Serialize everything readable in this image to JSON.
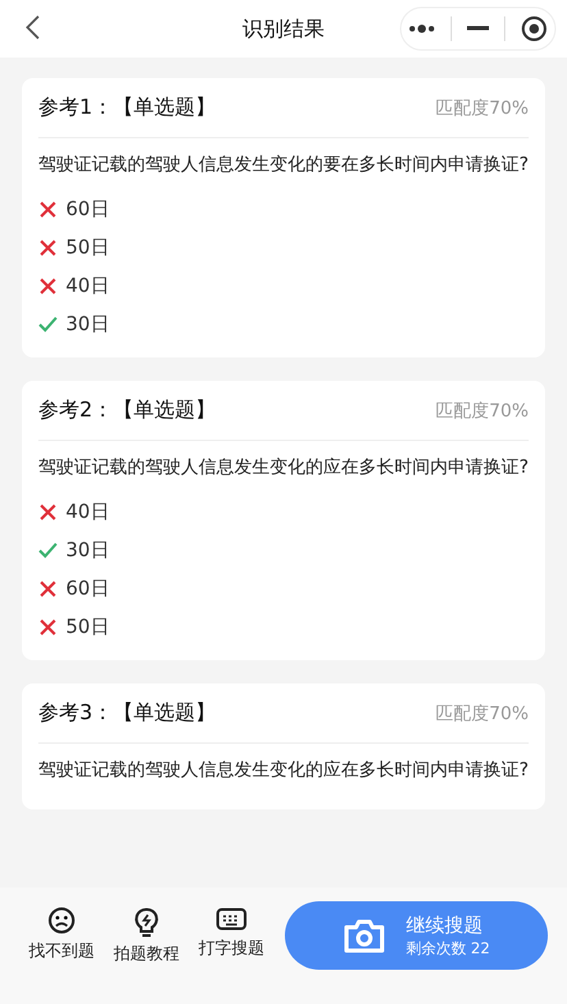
{
  "header": {
    "title": "识别结果"
  },
  "results": [
    {
      "ref": "参考1：",
      "type": "【单选题】",
      "match": "匹配度70%",
      "question": "驾驶证记载的驾驶人信息发生变化的要在多长时间内申请换证?",
      "options": [
        {
          "text": "60日",
          "correct": false
        },
        {
          "text": "50日",
          "correct": false
        },
        {
          "text": "40日",
          "correct": false
        },
        {
          "text": "30日",
          "correct": true
        }
      ]
    },
    {
      "ref": "参考2：",
      "type": "【单选题】",
      "match": "匹配度70%",
      "question": "驾驶证记载的驾驶人信息发生变化的应在多长时间内申请换证?",
      "options": [
        {
          "text": "40日",
          "correct": false
        },
        {
          "text": "30日",
          "correct": true
        },
        {
          "text": "60日",
          "correct": false
        },
        {
          "text": "50日",
          "correct": false
        }
      ]
    },
    {
      "ref": "参考3：",
      "type": "【单选题】",
      "match": "匹配度70%",
      "question": "驾驶证记载的驾驶人信息发生变化的应在多长时间内申请换证?"
    }
  ],
  "bottom_bar": {
    "actions": [
      {
        "kind": "sad",
        "label": "找不到题"
      },
      {
        "kind": "bulb",
        "label": "拍题教程"
      },
      {
        "kind": "keyboard",
        "label": "打字搜题"
      }
    ],
    "search_button": {
      "label": "继续搜题",
      "remaining": "剩余次数 22"
    }
  }
}
